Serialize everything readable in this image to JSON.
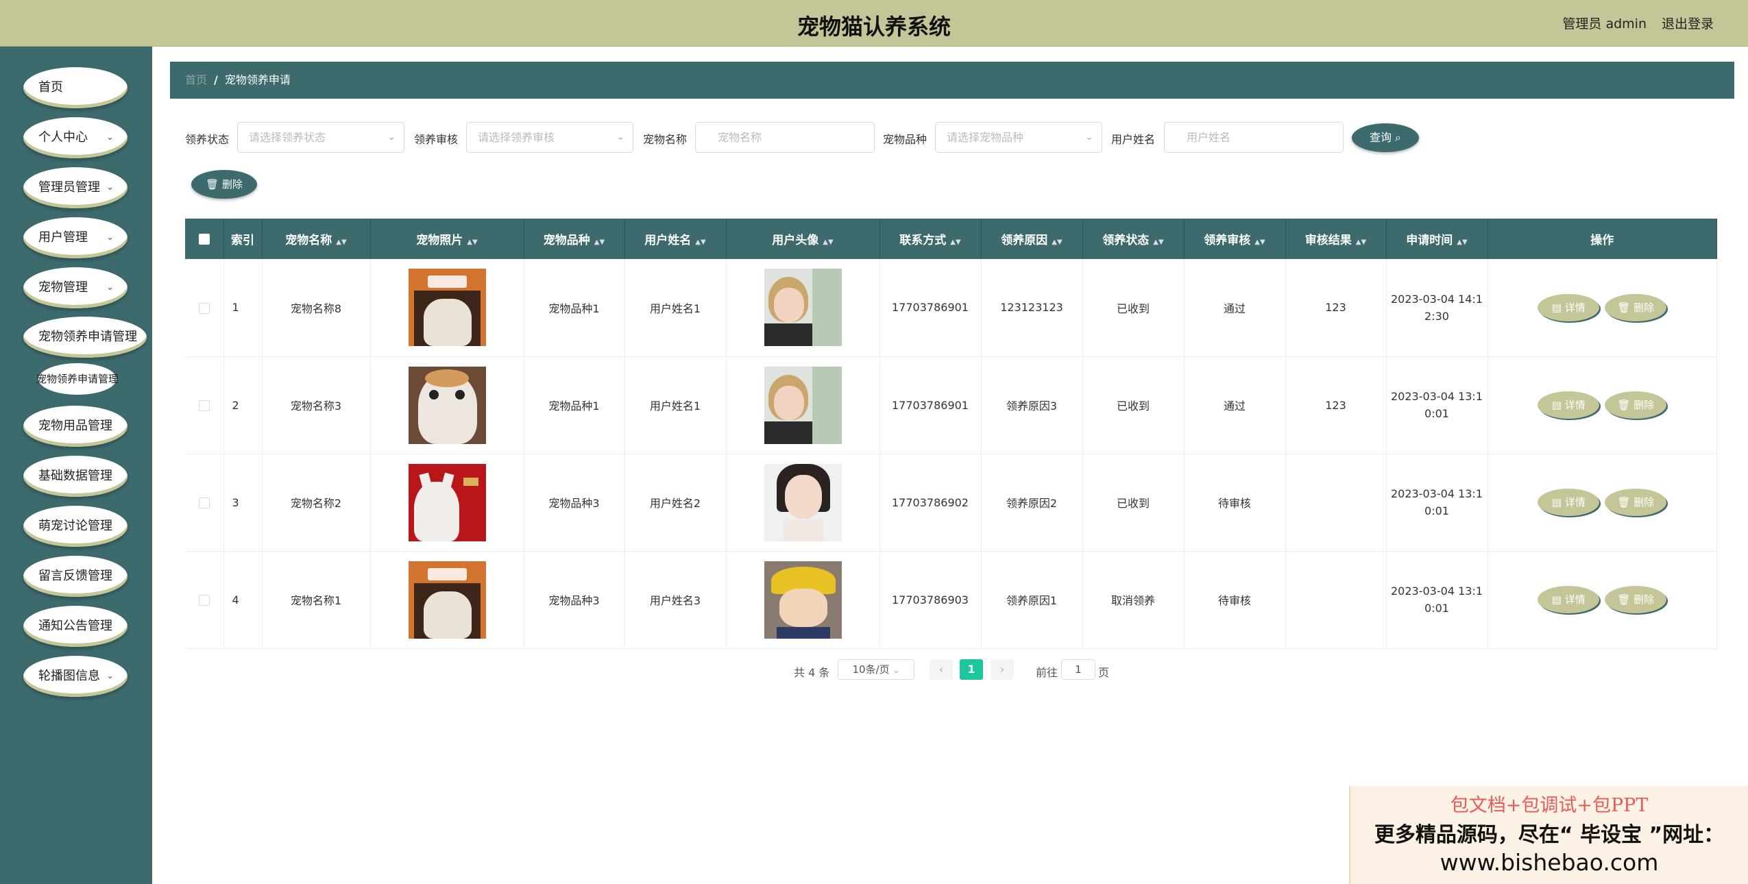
{
  "header": {
    "title": "宠物猫认养系统",
    "admin": "管理员 admin",
    "logout": "退出登录"
  },
  "sidebar": {
    "items": [
      "首页",
      "个人中心",
      "管理员管理",
      "用户管理",
      "宠物管理",
      "宠物领养申请管理",
      "宠物用品管理",
      "基础数据管理",
      "萌宠讨论管理",
      "留言反馈管理",
      "通知公告管理",
      "轮播图信息"
    ],
    "submenu": "宠物领养申请管理"
  },
  "breadcrumb": {
    "home": "首页",
    "sep": "/",
    "current": "宠物领养申请"
  },
  "filters": {
    "status_label": "领养状态",
    "status_placeholder": "请选择领养状态",
    "review_label": "领养审核",
    "review_placeholder": "请选择领养审核",
    "petname_label": "宠物名称",
    "petname_placeholder": "宠物名称",
    "breed_label": "宠物品种",
    "breed_placeholder": "请选择宠物品种",
    "username_label": "用户姓名",
    "username_placeholder": "用户姓名",
    "query": "查询 ⌕"
  },
  "toolbar": {
    "delete": "🗑 删除"
  },
  "table": {
    "headers": [
      "索引",
      "宠物名称",
      "宠物照片",
      "宠物品种",
      "用户姓名",
      "用户头像",
      "联系方式",
      "领养原因",
      "领养状态",
      "领养审核",
      "审核结果",
      "申请时间",
      "操作"
    ],
    "rows": [
      {
        "index": "1",
        "name": "宠物名称8",
        "breed": "宠物品种1",
        "user": "用户姓名1",
        "phone": "17703786901",
        "reason": "123123123",
        "status": "已收到",
        "review": "通过",
        "result": "123",
        "time1": "2023-03-04 14:1",
        "time2": "2:30"
      },
      {
        "index": "2",
        "name": "宠物名称3",
        "breed": "宠物品种1",
        "user": "用户姓名1",
        "phone": "17703786901",
        "reason": "领养原因3",
        "status": "已收到",
        "review": "通过",
        "result": "123",
        "time1": "2023-03-04 13:1",
        "time2": "0:01"
      },
      {
        "index": "3",
        "name": "宠物名称2",
        "breed": "宠物品种3",
        "user": "用户姓名2",
        "phone": "17703786902",
        "reason": "领养原因2",
        "status": "已收到",
        "review": "待审核",
        "result": "",
        "time1": "2023-03-04 13:1",
        "time2": "0:01"
      },
      {
        "index": "4",
        "name": "宠物名称1",
        "breed": "宠物品种3",
        "user": "用户姓名3",
        "phone": "17703786903",
        "reason": "领养原因1",
        "status": "取消领养",
        "review": "待审核",
        "result": "",
        "time1": "2023-03-04 13:1",
        "time2": "0:01"
      }
    ],
    "detail_btn": "▤ 详情",
    "delete_btn": "🗑 删除"
  },
  "pagination": {
    "total": "共 4 条",
    "page_size": "10条/页",
    "prev": "‹",
    "current": "1",
    "next": "›",
    "goto_label": "前往",
    "goto_value": "1",
    "page_suffix": "页"
  },
  "ad": {
    "line1": "包文档+包调试+包PPT",
    "line2": "更多精品源码，尽在“ 毕设宝 ”网址：",
    "line3": "www.bishebao.com"
  },
  "colors": {
    "header": "#c5c697",
    "sidebar": "#3c6a6d",
    "accent": "#1ec6a0"
  }
}
